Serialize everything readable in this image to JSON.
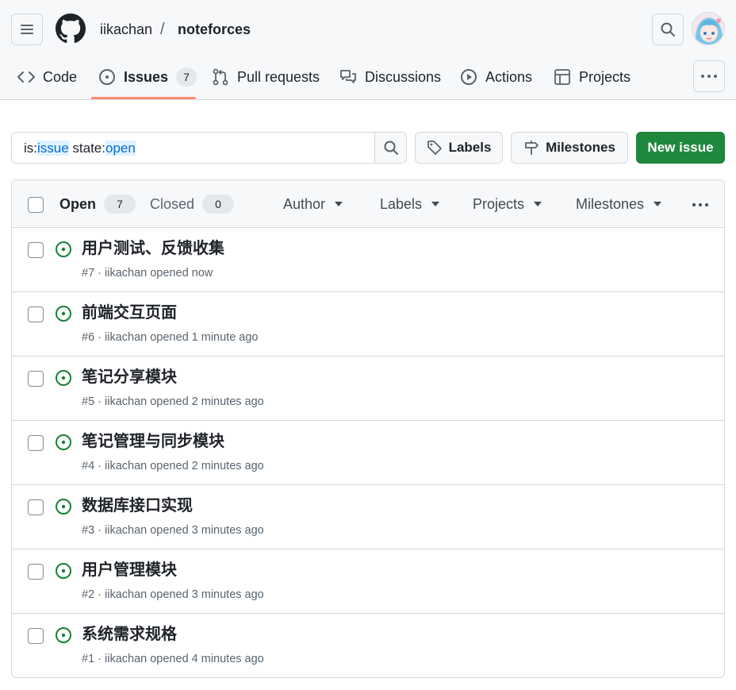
{
  "header": {
    "owner": "iikachan",
    "separator": "/",
    "repo": "noteforces"
  },
  "tabs": [
    {
      "label": "Code",
      "icon": "code-icon"
    },
    {
      "label": "Issues",
      "icon": "issue-opened-icon",
      "count": "7",
      "selected": true
    },
    {
      "label": "Pull requests",
      "icon": "git-pull-request-icon"
    },
    {
      "label": "Discussions",
      "icon": "comment-discussion-icon"
    },
    {
      "label": "Actions",
      "icon": "play-icon"
    },
    {
      "label": "Projects",
      "icon": "table-icon"
    }
  ],
  "toolbar": {
    "filter_prefix_1": "is:",
    "filter_value_1": "issue",
    "filter_prefix_2": " state:",
    "filter_value_2": "open",
    "labels_button": "Labels",
    "milestones_button": "Milestones",
    "new_issue_button": "New issue"
  },
  "list_header": {
    "open_label": "Open",
    "open_count": "7",
    "closed_label": "Closed",
    "closed_count": "0",
    "filters": [
      "Author",
      "Labels",
      "Projects",
      "Milestones"
    ]
  },
  "issues": [
    {
      "title": "用户测试、反馈收集",
      "meta": "#7 · iikachan opened now"
    },
    {
      "title": "前端交互页面",
      "meta": "#6 · iikachan opened 1 minute ago"
    },
    {
      "title": "笔记分享模块",
      "meta": "#5 · iikachan opened 2 minutes ago"
    },
    {
      "title": "笔记管理与同步模块",
      "meta": "#4 · iikachan opened 2 minutes ago"
    },
    {
      "title": "数据库接口实现",
      "meta": "#3 · iikachan opened 3 minutes ago"
    },
    {
      "title": "用户管理模块",
      "meta": "#2 · iikachan opened 3 minutes ago"
    },
    {
      "title": "系统需求规格",
      "meta": "#1 · iikachan opened 4 minutes ago"
    }
  ],
  "colors": {
    "accent_green": "#1f883d",
    "open_icon": "#1a7f37",
    "tab_underline": "#fd8c73",
    "link_blue": "#0969da"
  }
}
